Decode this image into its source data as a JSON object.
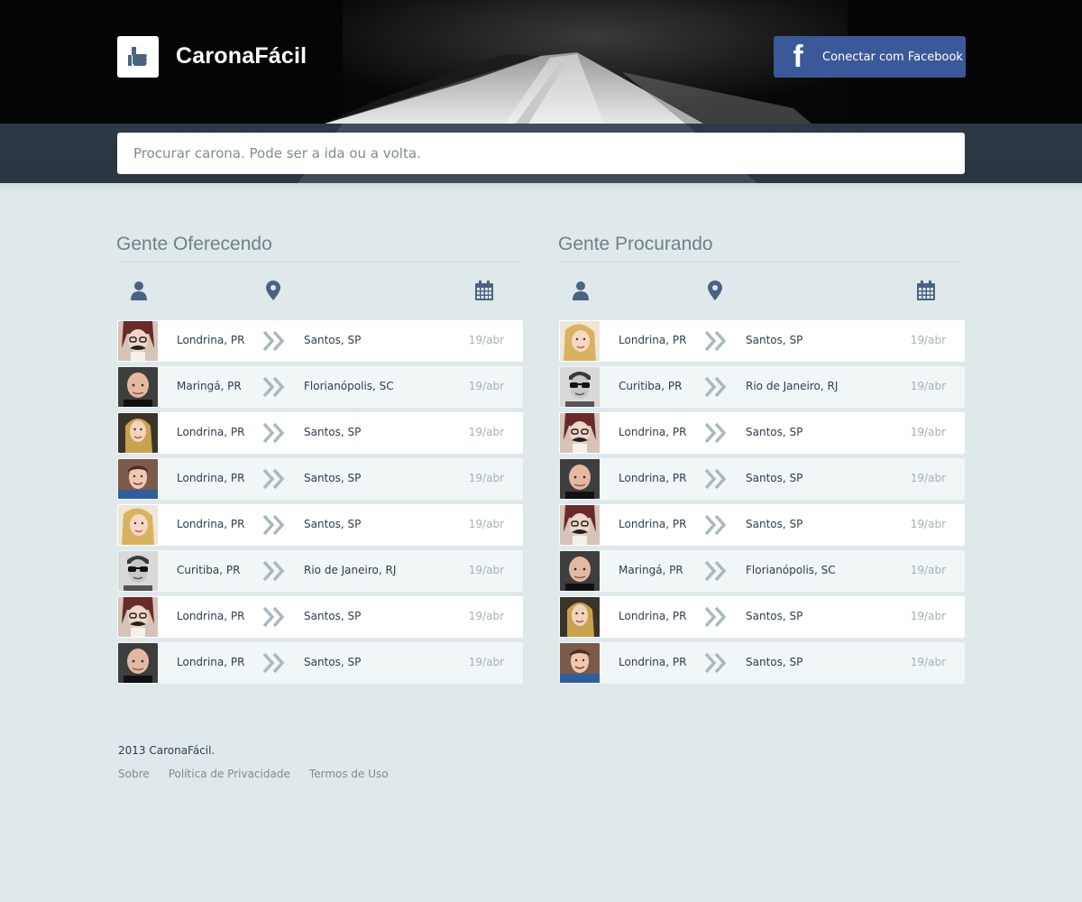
{
  "header": {
    "brand": "CaronaFácil",
    "facebook_button": "Conectar com Facebook",
    "facebook_glyph": "f"
  },
  "search": {
    "placeholder": "Procurar carona. Pode ser a ida ou a volta."
  },
  "offering": {
    "title": "Gente Oferecendo",
    "rows": [
      {
        "avatar": "woman-glasses-mustache",
        "from": "Londrina, PR",
        "to": "Santos, SP",
        "date": "19/abr"
      },
      {
        "avatar": "bald-man",
        "from": "Maringá, PR",
        "to": "Florianópolis, SC",
        "date": "19/abr"
      },
      {
        "avatar": "blonde-woman",
        "from": "Londrina, PR",
        "to": "Santos, SP",
        "date": "19/abr"
      },
      {
        "avatar": "young-man",
        "from": "Londrina, PR",
        "to": "Santos, SP",
        "date": "19/abr"
      },
      {
        "avatar": "blonde-woman-2",
        "from": "Londrina, PR",
        "to": "Santos, SP",
        "date": "19/abr"
      },
      {
        "avatar": "man-sunglasses",
        "from": "Curitiba, PR",
        "to": "Rio de Janeiro, RJ",
        "date": "19/abr"
      },
      {
        "avatar": "woman-glasses-mustache",
        "from": "Londrina, PR",
        "to": "Santos, SP",
        "date": "19/abr"
      },
      {
        "avatar": "bald-man",
        "from": "Londrina, PR",
        "to": "Santos, SP",
        "date": "19/abr"
      }
    ]
  },
  "seeking": {
    "title": "Gente Procurando",
    "rows": [
      {
        "avatar": "blonde-woman-2",
        "from": "Londrina, PR",
        "to": "Santos, SP",
        "date": "19/abr"
      },
      {
        "avatar": "man-sunglasses",
        "from": "Curitiba, PR",
        "to": "Rio de Janeiro, RJ",
        "date": "19/abr"
      },
      {
        "avatar": "woman-glasses-mustache",
        "from": "Londrina, PR",
        "to": "Santos, SP",
        "date": "19/abr"
      },
      {
        "avatar": "bald-man",
        "from": "Londrina, PR",
        "to": "Santos, SP",
        "date": "19/abr"
      },
      {
        "avatar": "woman-glasses-mustache",
        "from": "Londrina, PR",
        "to": "Santos, SP",
        "date": "19/abr"
      },
      {
        "avatar": "bald-man",
        "from": "Maringá, PR",
        "to": "Florianópolis, SC",
        "date": "19/abr"
      },
      {
        "avatar": "blonde-woman",
        "from": "Londrina, PR",
        "to": "Santos, SP",
        "date": "19/abr"
      },
      {
        "avatar": "young-man",
        "from": "Londrina, PR",
        "to": "Santos, SP",
        "date": "19/abr"
      }
    ]
  },
  "column_icons": [
    "user-icon",
    "map-marker-icon",
    "calendar-icon"
  ],
  "footer": {
    "copyright": "2013 CaronaFácil.",
    "links": [
      "Sobre",
      "Política de Privacidade",
      "Termos de Uso"
    ]
  },
  "colors": {
    "header_bg": "#050505",
    "band_bg": "#2c3845",
    "page_bg": "#dfe9eb",
    "facebook": "#3b5998",
    "icon": "#4b6382",
    "arrow": "#a9b9bf",
    "text": "#2c3e50",
    "muted": "#a4b1b4"
  }
}
